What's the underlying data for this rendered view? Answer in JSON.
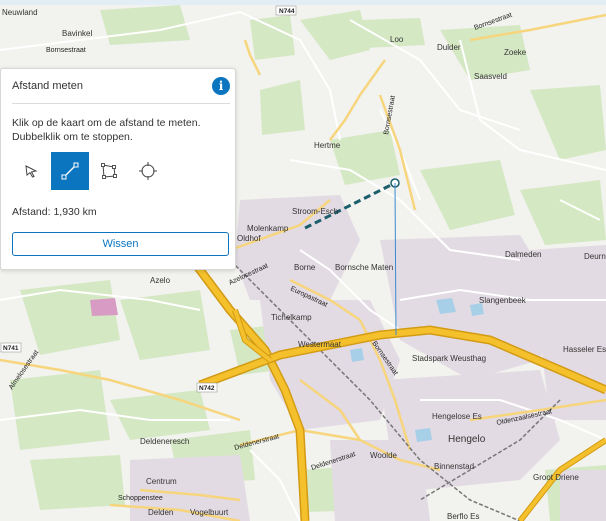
{
  "panel": {
    "title": "Afstand meten",
    "description": "Klik op de kaart om de afstand te meten. Dubbelklik om te stoppen.",
    "distance_label": "Afstand: 1,930 km",
    "clear_button": "Wissen",
    "tools": [
      {
        "name": "select-tool",
        "icon": "pointer-icon",
        "active": false
      },
      {
        "name": "line-tool",
        "icon": "line-icon",
        "active": true
      },
      {
        "name": "polygon-tool",
        "icon": "polygon-icon",
        "active": false
      },
      {
        "name": "circle-tool",
        "icon": "circle-crosshair-icon",
        "active": false
      }
    ]
  },
  "map": {
    "places": [
      "Neuwland",
      "Bavinkel",
      "Bornsestraat",
      "Loo",
      "Dulder",
      "Zoeke",
      "Saasveld",
      "Hertme",
      "Stroom-Esch",
      "Molenkamp",
      "Oldhof",
      "Azelo",
      "Borne",
      "Bornsche Maten",
      "Dalmeden",
      "Deurningen",
      "Slangenbeek",
      "Tichelkamp",
      "Westermaat",
      "Stadspark Weusthag",
      "Hasseler Es",
      "Hengelose Es",
      "Hengelo",
      "Binnenstad",
      "Woolde",
      "Groot Driene",
      "Deldeneresch",
      "Centrum",
      "Delden",
      "Vogelbuurt",
      "Berflo Es"
    ],
    "roads": [
      "Bornsestraat",
      "Azelosestraat",
      "Europastraat",
      "Bornsestraat",
      "Almelosestraat",
      "Deldenerstraat",
      "Deldenerstraat",
      "Oldenzaalsestraat",
      "Schoppenstee",
      "Bornsestraat"
    ],
    "shields": [
      "N744",
      "N741",
      "N742"
    ],
    "colors": {
      "highway": "#f4c12c",
      "water": "#a8cfe8",
      "forest": "#d5e8c4",
      "urban": "#e3dbe3",
      "measure": "#1b5e6b"
    }
  }
}
